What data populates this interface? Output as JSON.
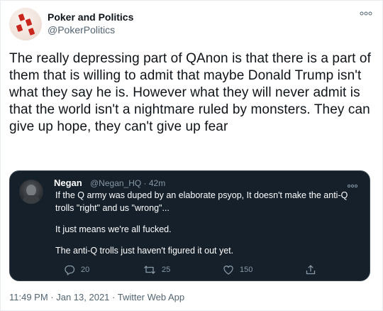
{
  "author": {
    "name": "Poker and Politics",
    "handle": "@PokerPolitics"
  },
  "tweet": {
    "text": "The really depressing part of QAnon is that there is a part of them that is willing to admit that maybe Donald Trump isn't what they say he is. However what they will never admit is that the world isn't a nightmare ruled by monsters. They can give up hope, they can't give up fear",
    "timestamp": "11:49 PM · Jan 13, 2021 · Twitter Web App"
  },
  "quoted": {
    "name": "Negan",
    "handle_time": "@Negan_HQ · 42m",
    "line1": "If the Q army was duped by an elaborate psyop, It doesn't make the anti-Q trolls \"right\" and us \"wrong\"...",
    "line2": "It just means we're all fucked.",
    "line3": "The anti-Q trolls just haven't figured it out yet.",
    "replies": "20",
    "retweets": "25",
    "likes": "150"
  },
  "icons": {
    "more": "more-icon",
    "reply": "reply-icon",
    "retweet": "retweet-icon",
    "like": "like-icon",
    "share": "share-icon"
  },
  "colors": {
    "quote_background": "#15202b",
    "secondary_text": "#536471",
    "dark_secondary_text": "#8899a6"
  }
}
